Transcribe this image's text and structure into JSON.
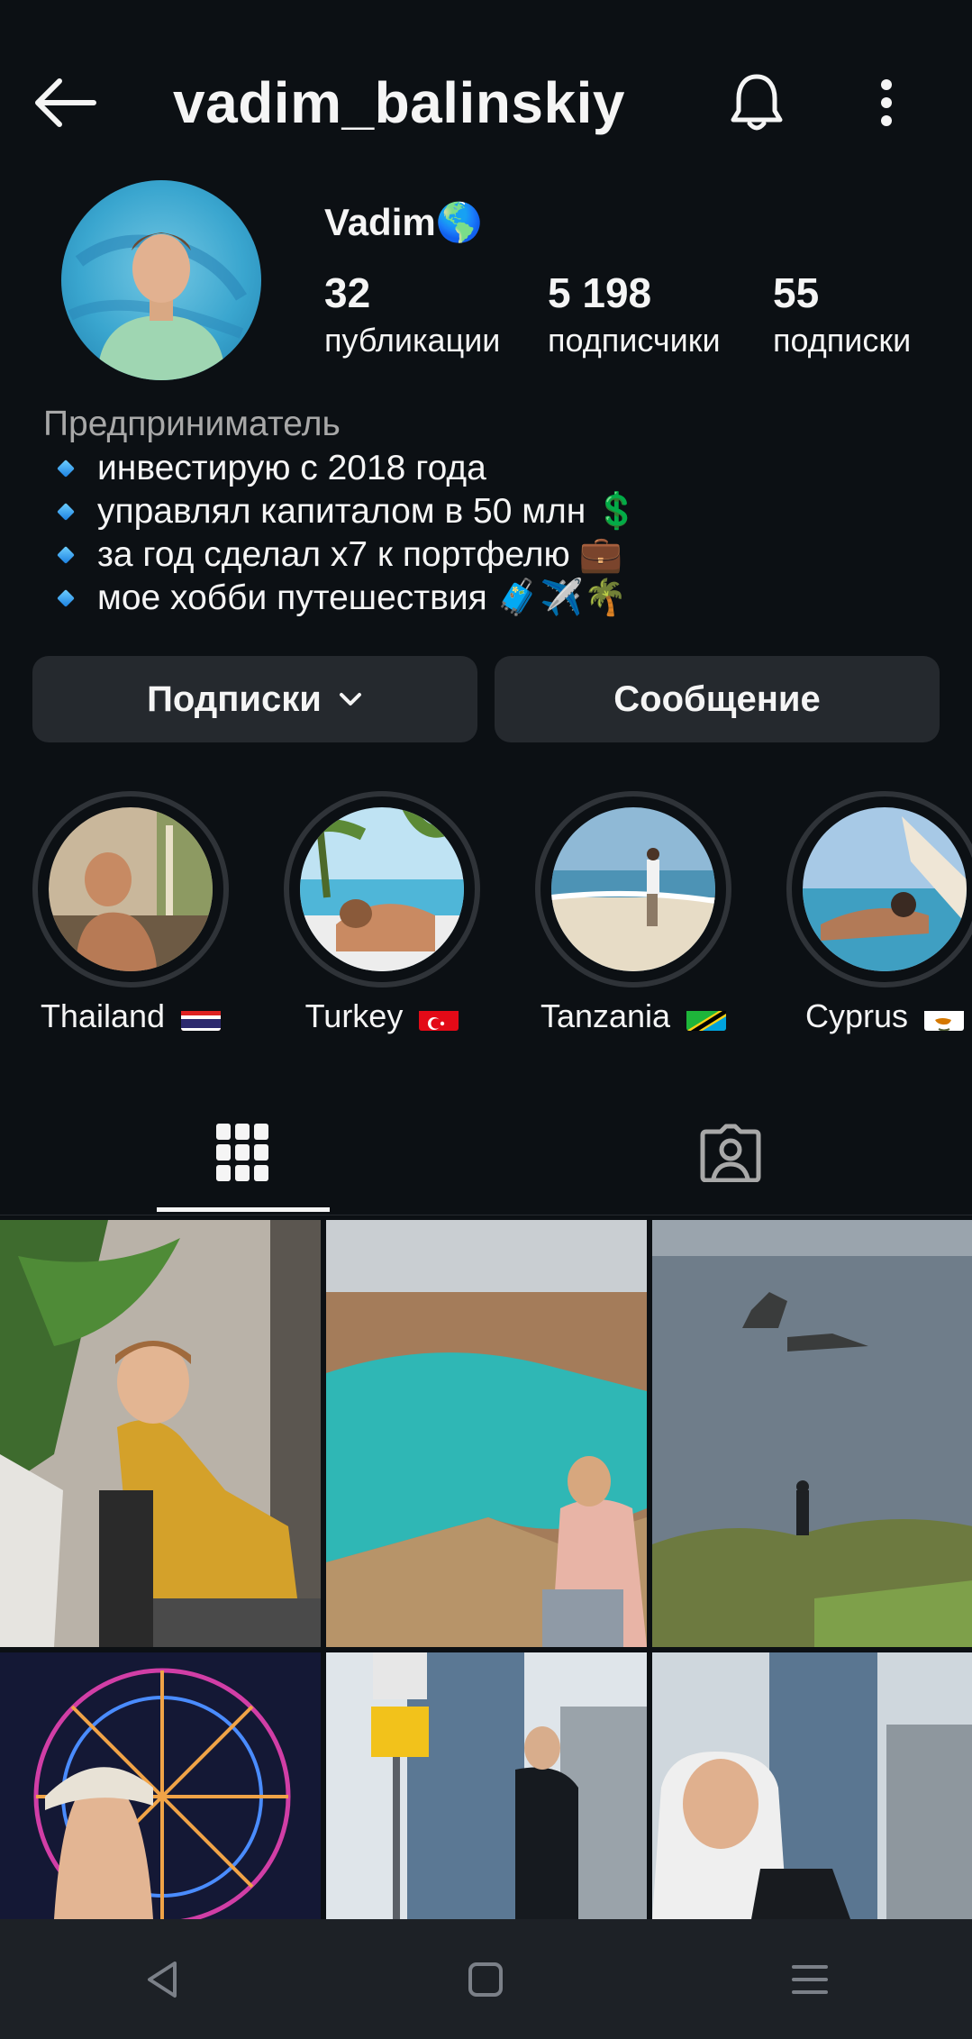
{
  "header": {
    "username": "vadim_balinskiy"
  },
  "profile": {
    "display_name": "Vadim",
    "display_name_emoji": "🌎",
    "stats": {
      "posts": {
        "value": "32",
        "label": "публикации"
      },
      "followers": {
        "value": "5 198",
        "label": "подписчики"
      },
      "following": {
        "value": "55",
        "label": "подписки"
      }
    },
    "category": "Предприниматель",
    "bio": [
      {
        "text": "инвестирую с 2018 года",
        "emoji": ""
      },
      {
        "text": "управлял капиталом в 50 млн",
        "emoji": "💲"
      },
      {
        "text": "за год сделал х7 к портфелю",
        "emoji": "💼"
      },
      {
        "text": "мое хобби путешествия",
        "emoji": "🧳✈️🌴"
      }
    ]
  },
  "actions": {
    "following_label": "Подписки",
    "message_label": "Сообщение"
  },
  "highlights": [
    {
      "label": "Thailand",
      "flag": "thailand"
    },
    {
      "label": "Turkey",
      "flag": "turkey"
    },
    {
      "label": "Tanzania",
      "flag": "tanzania"
    },
    {
      "label": "Cyprus",
      "flag": "cyprus"
    }
  ],
  "tabs": [
    {
      "icon": "grid-icon",
      "active": true
    },
    {
      "icon": "tagged-icon",
      "active": false
    }
  ],
  "colors": {
    "background": "#0c1014",
    "button": "#25292e",
    "secondary_text": "#a8a8a8",
    "navbar": "#1d2126"
  }
}
